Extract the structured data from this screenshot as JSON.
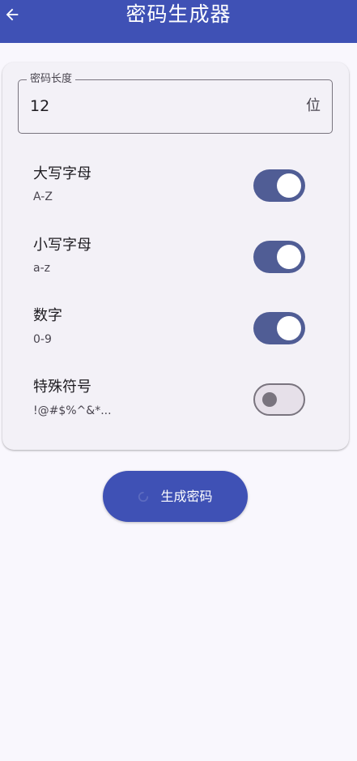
{
  "appbar": {
    "title": "密码生成器",
    "back_icon": "arrow-left-icon"
  },
  "length_field": {
    "label": "密码长度",
    "value": "12",
    "suffix": "位"
  },
  "options": [
    {
      "title": "大写字母",
      "subtitle": "A-Z",
      "enabled": true
    },
    {
      "title": "小写字母",
      "subtitle": "a-z",
      "enabled": true
    },
    {
      "title": "数字",
      "subtitle": "0-9",
      "enabled": true
    },
    {
      "title": "特殊符号",
      "subtitle": "!@#$%^&*...",
      "enabled": false
    }
  ],
  "generate_button": {
    "label": "生成密码",
    "icon": "loading-spinner-icon"
  },
  "colors": {
    "primary": "#3f51b5",
    "switch_on": "#505d95",
    "switch_off_track": "#e6e0e9",
    "card": "#f3f1f7",
    "background": "#f9f7fd"
  }
}
